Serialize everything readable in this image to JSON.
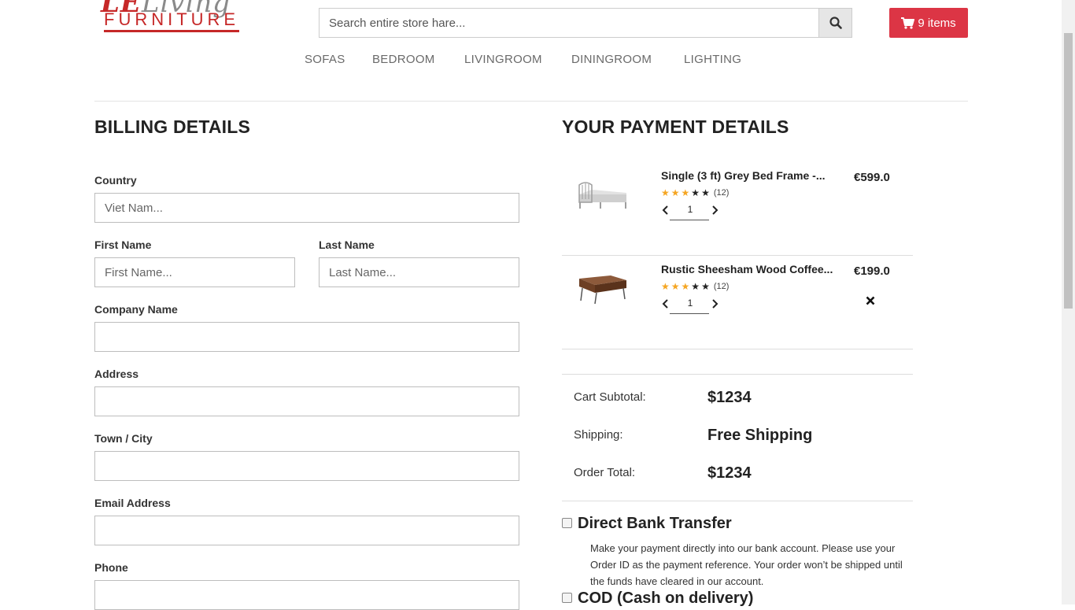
{
  "brand": {
    "script": "LE",
    "script_tail": "Living",
    "name": "FURNITURE"
  },
  "header": {
    "search_placeholder": "Search entire store hare...",
    "cart_label": "9 items"
  },
  "nav": {
    "items": [
      "SOFAS",
      "BEDROOM",
      "LIVINGROOM",
      "DININGROOM",
      "LIGHTING"
    ]
  },
  "billing": {
    "title": "BILLING DETAILS",
    "country_label": "Country",
    "country_placeholder": "Viet Nam...",
    "first_name_label": "First Name",
    "first_name_placeholder": "First Name...",
    "last_name_label": "Last Name",
    "last_name_placeholder": "Last Name...",
    "company_label": "Company Name",
    "address_label": "Address",
    "city_label": "Town / City",
    "email_label": "Email Address",
    "phone_label": "Phone"
  },
  "payment": {
    "title": "YOUR PAYMENT DETAILS",
    "items": [
      {
        "name": "Single (3 ft) Grey Bed Frame -...",
        "rating": 3,
        "max_rating": 5,
        "reviews": "(12)",
        "qty": "1",
        "price": "€599.0"
      },
      {
        "name": "Rustic Sheesham Wood Coffee...",
        "rating": 3,
        "max_rating": 5,
        "reviews": "(12)",
        "qty": "1",
        "price": "€199.0"
      }
    ],
    "subtotal_label": "Cart Subtotal:",
    "subtotal_value": "$1234",
    "shipping_label": "Shipping:",
    "shipping_value": "Free Shipping",
    "total_label": "Order Total:",
    "total_value": "$1234",
    "methods": [
      {
        "title": "Direct Bank Transfer",
        "description": "Make your payment directly into our bank account. Please use your Order ID as the payment reference. Your order won’t be shipped until the funds have cleared in our account."
      },
      {
        "title": "COD (Cash on delivery)"
      }
    ]
  },
  "colors": {
    "accent": "#dc3545",
    "brand_red": "#c62828",
    "star": "#f5a623"
  }
}
